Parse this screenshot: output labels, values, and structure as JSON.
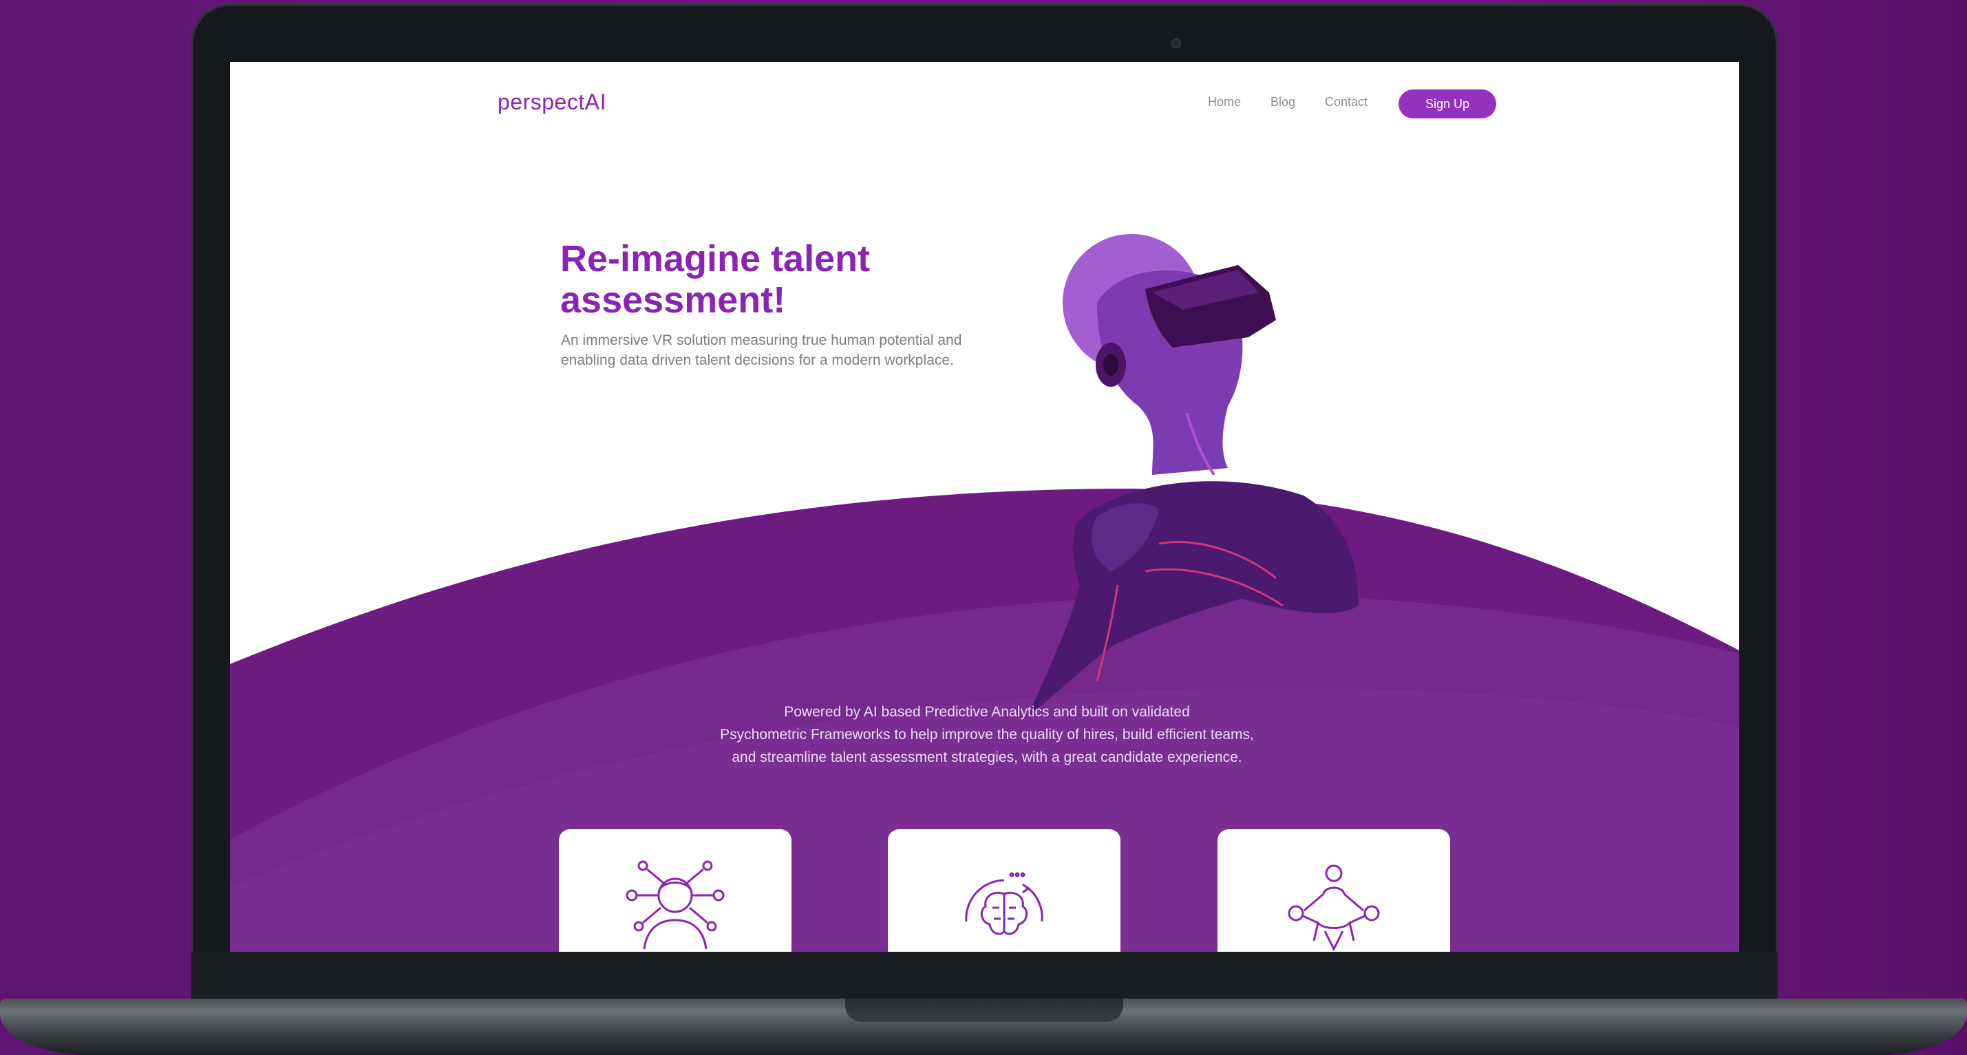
{
  "brand": {
    "logo": "perspectAI"
  },
  "nav": {
    "home": "Home",
    "blog": "Blog",
    "contact": "Contact",
    "signup": "Sign Up"
  },
  "hero": {
    "headline_line1": "Re-imagine talent",
    "headline_line2": "assessment!",
    "subtitle_line1": "An immersive VR solution measuring true human potential and",
    "subtitle_line2": "enabling data driven talent decisions for a modern workplace."
  },
  "features": {
    "text_line1": "Powered by AI based Predictive Analytics and built on validated",
    "text_line2": "Psychometric Frameworks to help improve the quality of hires, build efficient teams,",
    "text_line3": "and streamline talent assessment strategies, with a great candidate experience."
  },
  "cards": [
    {
      "icon": "person-network-icon"
    },
    {
      "icon": "brain-cycle-icon"
    },
    {
      "icon": "team-network-icon"
    }
  ],
  "colors": {
    "page_background": "#6a1a7c",
    "brand_purple": "#8b24b4",
    "button_purple": "#9531c0",
    "wave_purple": "#6c1c81",
    "wave_light": "#7a2d92"
  }
}
